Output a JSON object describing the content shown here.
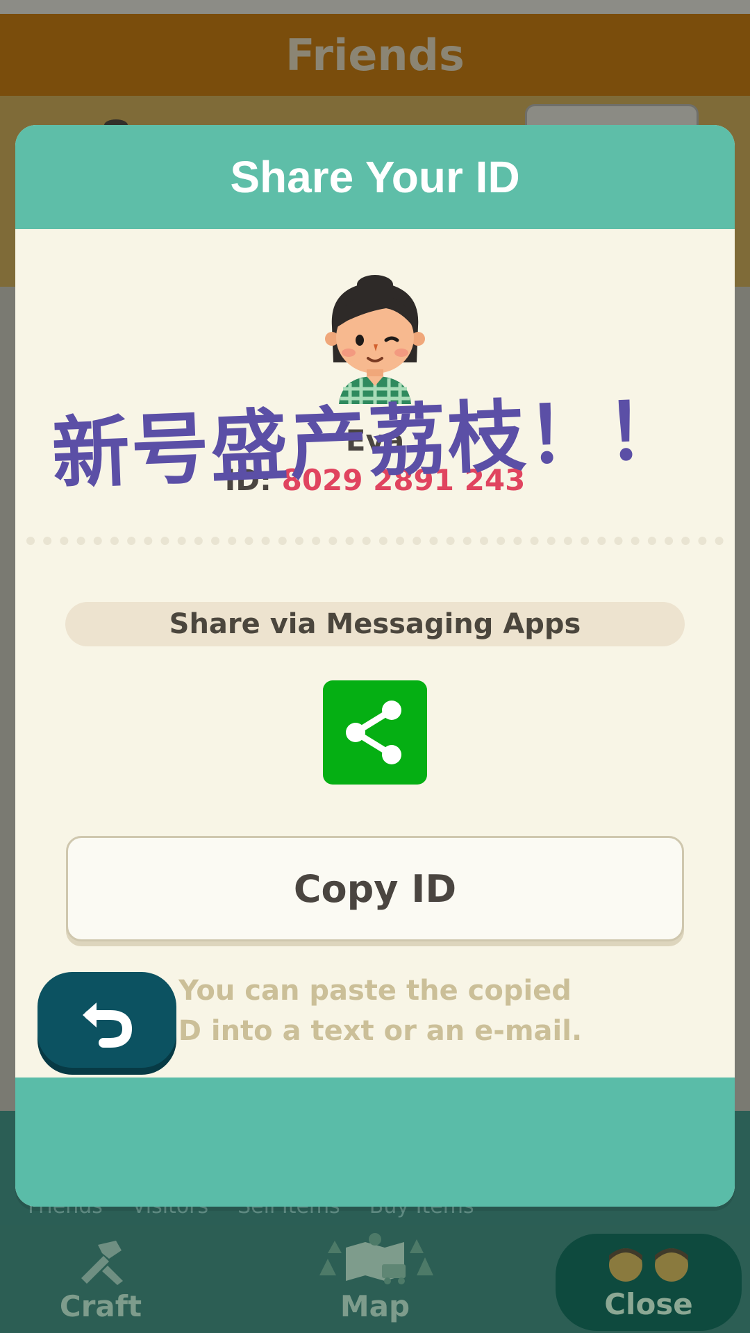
{
  "background": {
    "header_title": "Friends",
    "subtabs": [
      "Friends",
      "Visitors",
      "Sell Items",
      "Buy Items"
    ]
  },
  "bottom_nav": {
    "craft_label": "Craft",
    "map_label": "Map",
    "close_label": "Close"
  },
  "modal": {
    "title": "Share Your ID",
    "player_name": "Eva",
    "id_prefix": "ID: ",
    "id_value": "8029 2891 243",
    "overlay_text": "新号盛产荔枝！！",
    "share_section_label": "Share via Messaging Apps",
    "share_icon": "share-icon",
    "copy_button_label": "Copy ID",
    "helper_line1": "You can paste the copied",
    "helper_line2": "ID into a text or an e-mail.",
    "back_icon": "back-arrow-icon"
  },
  "colors": {
    "header_teal": "#5ebea8",
    "id_red": "#e0445f",
    "share_green": "#05af13",
    "back_button": "#0c5261",
    "overlay_purple": "#5b4fa6"
  }
}
